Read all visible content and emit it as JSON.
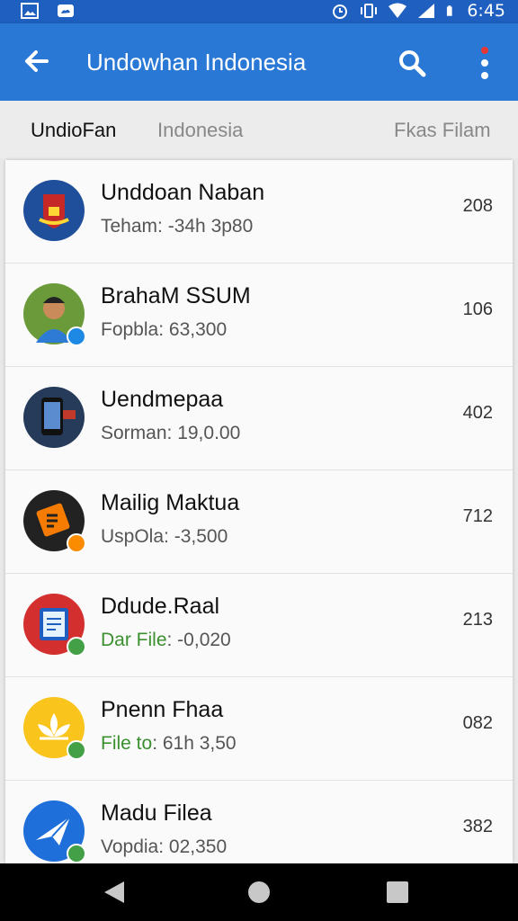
{
  "status_bar": {
    "time": "6:45"
  },
  "app_bar": {
    "title": "Undowhan Indonesia"
  },
  "tabs": [
    {
      "label": "UndioFan",
      "active": true
    },
    {
      "label": "Indonesia",
      "active": false
    },
    {
      "label": "Fkas Filam",
      "active": false
    }
  ],
  "list": [
    {
      "name": "Unddoan Naban",
      "sub_label": "Teham",
      "sub_value": ": -34h 3p80",
      "count": "208",
      "icon": "emblem-icon",
      "badge": ""
    },
    {
      "name": "BrahaM SSUM",
      "sub_label": "Fopbla",
      "sub_value": ": 63,300",
      "count": "106",
      "icon": "person-photo-icon",
      "badge": "verified-badge-icon"
    },
    {
      "name": "Uendmepaa",
      "sub_label": "Sorman",
      "sub_value": ": 19,0.00",
      "count": "402",
      "icon": "phone-device-icon",
      "badge": ""
    },
    {
      "name": "Mailig Maktua",
      "sub_label": "UspOla",
      "sub_value": ": -3,500",
      "count": "712",
      "icon": "document-app-icon",
      "badge": "orange-badge-icon"
    },
    {
      "name": "Ddude.Raal",
      "sub_label": "Dar File",
      "sub_value": ": -0,020",
      "count": "213",
      "icon": "file-manager-icon",
      "badge": "check-badge-icon"
    },
    {
      "name": "Pnenn Fhaa",
      "sub_label": "File to",
      "sub_value": ": 61h 3,50",
      "count": "082",
      "icon": "lotus-icon",
      "badge": "check-badge-icon"
    },
    {
      "name": "Madu Filea",
      "sub_label": "Vopdia",
      "sub_value": ": 02,350",
      "count": "382",
      "icon": "paper-plane-icon",
      "badge": "check-badge-icon"
    }
  ],
  "colors": {
    "status_bar": "#1f5fbf",
    "app_bar": "#2a78d6",
    "accent_green": "#3a8f2e"
  }
}
